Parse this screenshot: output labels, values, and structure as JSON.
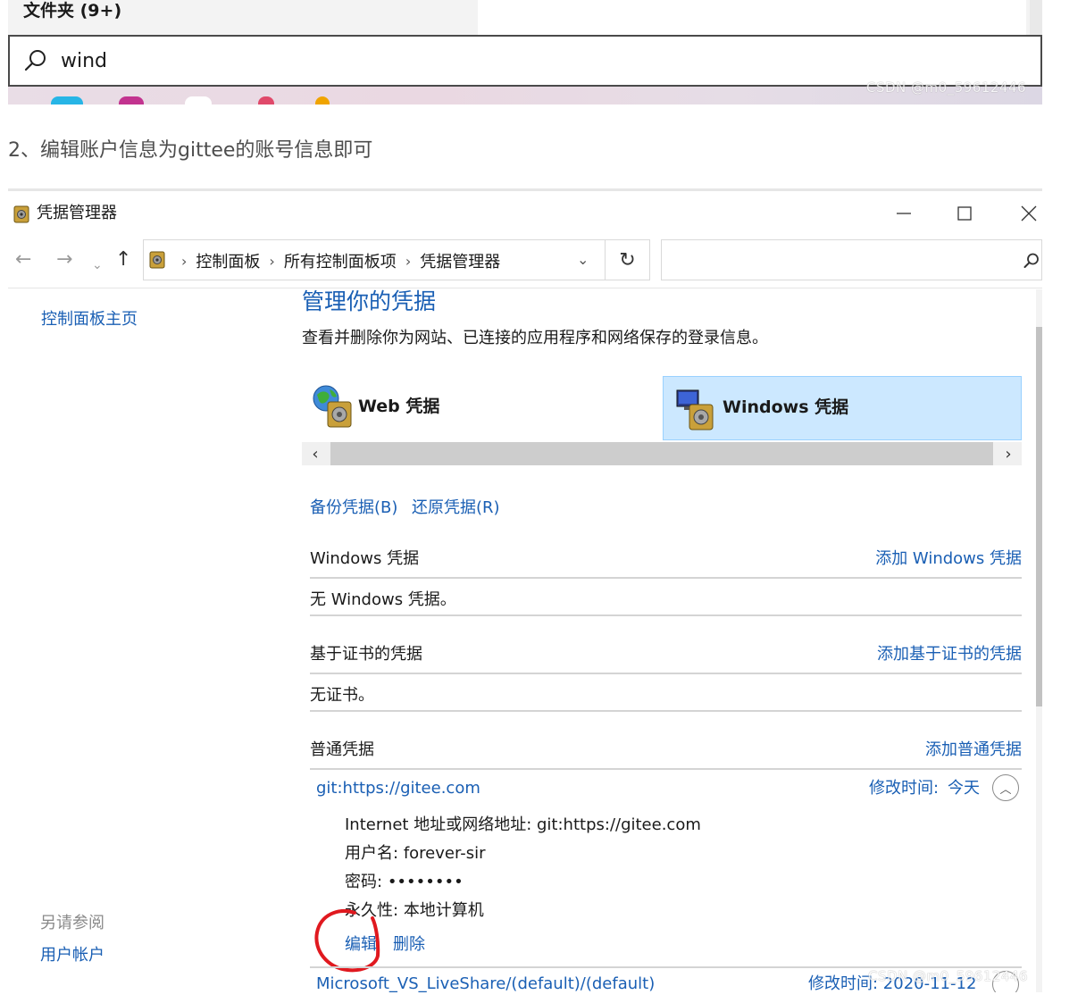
{
  "snippet": {
    "folder_header": "文件夹 (9+)",
    "search_query": "wind"
  },
  "watermark_top": "CSDN @m0_59612446",
  "watermark_bottom": "CSDN @m0_59612446",
  "step_text": "2、编辑账户信息为gittee的账号信息即可",
  "window": {
    "title": "凭据管理器",
    "breadcrumbs": [
      "控制面板",
      "所有控制面板项",
      "凭据管理器"
    ],
    "search_placeholder": ""
  },
  "left_pane": {
    "home_link": "控制面板主页",
    "see_also": "另请参阅",
    "user_accounts": "用户帐户"
  },
  "main": {
    "title": "管理你的凭据",
    "description": "查看并删除你为网站、已连接的应用程序和网络保存的登录信息。",
    "tiles": [
      {
        "label": "Web 凭据",
        "selected": false
      },
      {
        "label": "Windows 凭据",
        "selected": true
      }
    ],
    "backup_link": "备份凭据(B)",
    "restore_link": "还原凭据(R)",
    "sections": [
      {
        "title": "Windows 凭据",
        "action": "添加 Windows 凭据",
        "body": "无 Windows 凭据。"
      },
      {
        "title": "基于证书的凭据",
        "action": "添加基于证书的凭据",
        "body": "无证书。"
      },
      {
        "title": "普通凭据",
        "action": "添加普通凭据"
      }
    ],
    "generic_credential": {
      "name": "git:https://gitee.com",
      "modified_label": "修改时间:",
      "modified_value": "今天",
      "details": [
        {
          "key": "Internet 地址或网络地址:",
          "value": "git:https://gitee.com"
        },
        {
          "key": "用户名:",
          "value": "forever-sir"
        },
        {
          "key": "密码:",
          "value": "••••••••"
        },
        {
          "key": "永久性:",
          "value": "本地计算机"
        }
      ],
      "edit_link": "编辑",
      "delete_link": "删除"
    },
    "second_credential": {
      "name": "Microsoft_VS_LiveShare/(default)/(default)",
      "modified": "修改时间: 2020-11-12"
    }
  },
  "colors": {
    "link_blue": "#1a5fb4",
    "selected_tile_bg": "#cce8ff",
    "annotation_red": "#e0191f"
  },
  "icons": {
    "search": "magnifier-icon",
    "app": "credential-vault-icon",
    "refresh": "refresh-icon"
  }
}
